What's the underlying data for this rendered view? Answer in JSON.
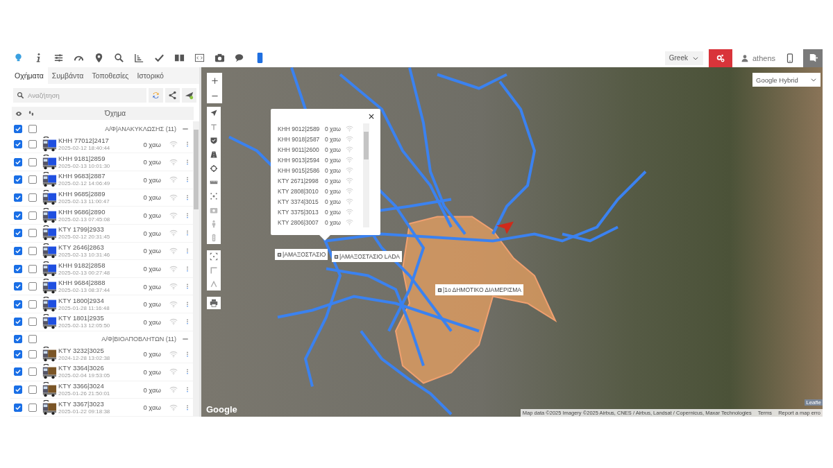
{
  "toolbar": {
    "language": "Greek",
    "user": "athens"
  },
  "tabs": [
    {
      "label": "Οχήματα",
      "selected": true
    },
    {
      "label": "Συμβάντα",
      "selected": false
    },
    {
      "label": "Τοποθεσίες",
      "selected": false
    },
    {
      "label": "Ιστορικό",
      "selected": false
    }
  ],
  "search": {
    "placeholder": "Αναζήτηση"
  },
  "list_header": {
    "column": "Όχημα"
  },
  "groups": [
    {
      "title": "Α/Φ|ΑΝΑΚΥΚΛΩΣΗΣ (11)",
      "checked": true,
      "trail": false,
      "vehicles": [
        {
          "plate": "ΚΗΗ 77012|2417",
          "time": "2025-02-12 18:40:44",
          "status": "0 χαω",
          "color": "#1f4fe0",
          "checked": true,
          "trail": false
        },
        {
          "plate": "ΚΗΗ 9181|2859",
          "time": "2025-02-13 10:01:30",
          "status": "0 χαω",
          "color": "#1f4fe0",
          "checked": true,
          "trail": false
        },
        {
          "plate": "ΚΗΗ 9683|2887",
          "time": "2025-02-12 14:06:49",
          "status": "0 χαω",
          "color": "#1f4fe0",
          "checked": true,
          "trail": false
        },
        {
          "plate": "ΚΗΗ 9685|2889",
          "time": "2025-02-13 11:00:47",
          "status": "0 χαω",
          "color": "#1f4fe0",
          "checked": true,
          "trail": false
        },
        {
          "plate": "ΚΗΗ 9686|2890",
          "time": "2025-02-13 07:45:08",
          "status": "0 χαω",
          "color": "#1f4fe0",
          "checked": true,
          "trail": false
        },
        {
          "plate": "ΚΤΥ 1799|2933",
          "time": "2025-02-12 20:31:45",
          "status": "0 χαω",
          "color": "#1f4fe0",
          "checked": true,
          "trail": false
        },
        {
          "plate": "ΚΤΥ 2646|2863",
          "time": "2025-02-13 10:31:46",
          "status": "0 χαω",
          "color": "#1f4fe0",
          "checked": true,
          "trail": false
        },
        {
          "plate": "ΚΗΗ 9182|2858",
          "time": "2025-02-13 00:27:48",
          "status": "0 χαω",
          "color": "#1f4fe0",
          "checked": true,
          "trail": false
        },
        {
          "plate": "ΚΗΗ 9684|2888",
          "time": "2025-02-13 08:37:44",
          "status": "0 χαω",
          "color": "#1f4fe0",
          "checked": true,
          "trail": false
        },
        {
          "plate": "ΚΤΥ 1800|2934",
          "time": "2025-01-28 11:16:48",
          "status": "0 χαω",
          "color": "#1f4fe0",
          "checked": true,
          "trail": false
        },
        {
          "plate": "ΚΤΥ 1801|2935",
          "time": "2025-02-13 12:05:50",
          "status": "0 χαω",
          "color": "#1f4fe0",
          "checked": true,
          "trail": false
        }
      ]
    },
    {
      "title": "Α/Φ|ΒΙΟΑΠΟΒΛΗΤΩΝ (11)",
      "checked": true,
      "trail": false,
      "vehicles": [
        {
          "plate": "ΚΤΥ 3232|3025",
          "time": "2024-12-28 13:02:38",
          "status": "0 χαω",
          "color": "#7a5526",
          "checked": true,
          "trail": false
        },
        {
          "plate": "ΚΤΥ 3364|3026",
          "time": "2025-02-04 19:53:05",
          "status": "0 χαω",
          "color": "#7a5526",
          "checked": true,
          "trail": false
        },
        {
          "plate": "ΚΤΥ 3366|3024",
          "time": "2025-01-26 21:50:01",
          "status": "0 χαω",
          "color": "#7a5526",
          "checked": true,
          "trail": false
        },
        {
          "plate": "ΚΤΥ 3367|3023",
          "time": "2025-01-22 09:18:38",
          "status": "0 χαω",
          "color": "#7a5526",
          "checked": true,
          "trail": false
        }
      ]
    }
  ],
  "map": {
    "layer_select": "Google Hybrid",
    "popup": {
      "rows": [
        {
          "plate": "ΚΗΗ 9012|2589",
          "status": "0 χαω"
        },
        {
          "plate": "ΚΗΗ 9018|2587",
          "status": "0 χαω"
        },
        {
          "plate": "ΚΗΗ 9011|2600",
          "status": "0 χαω"
        },
        {
          "plate": "ΚΗΗ 9013|2594",
          "status": "0 χαω"
        },
        {
          "plate": "ΚΗΗ 9015|2586",
          "status": "0 χαω"
        },
        {
          "plate": "ΚΤΥ 2671|2998",
          "status": "0 χαω"
        },
        {
          "plate": "ΚΤΥ 2808|3010",
          "status": "0 χαω"
        },
        {
          "plate": "ΚΤΥ 3374|3015",
          "status": "0 χαω"
        },
        {
          "plate": "ΚΤΥ 3375|3013",
          "status": "0 χαω"
        },
        {
          "plate": "ΚΤΥ 2806|3007",
          "status": "0 χαω"
        }
      ]
    },
    "labels": [
      {
        "text": "|ΑΜΑΞΟΣΤΑΣΙΟ"
      },
      {
        "text": "|ΑΜΑΞΟΣΤΑΣΙΟ LADA"
      },
      {
        "text": "|1ο ΔΗΜΟΤΙΚΟ ΔΙΑΜΕΡΙΣΜΑ"
      }
    ],
    "logo": "Google",
    "attribution": "Map data ©2025 Imagery ©2025 Airbus, CNES / Airbus, Landsat / Copernicus, Maxar Technologies",
    "terms": "Terms",
    "report": "Report a map erro",
    "leaflet": "Leafle"
  }
}
